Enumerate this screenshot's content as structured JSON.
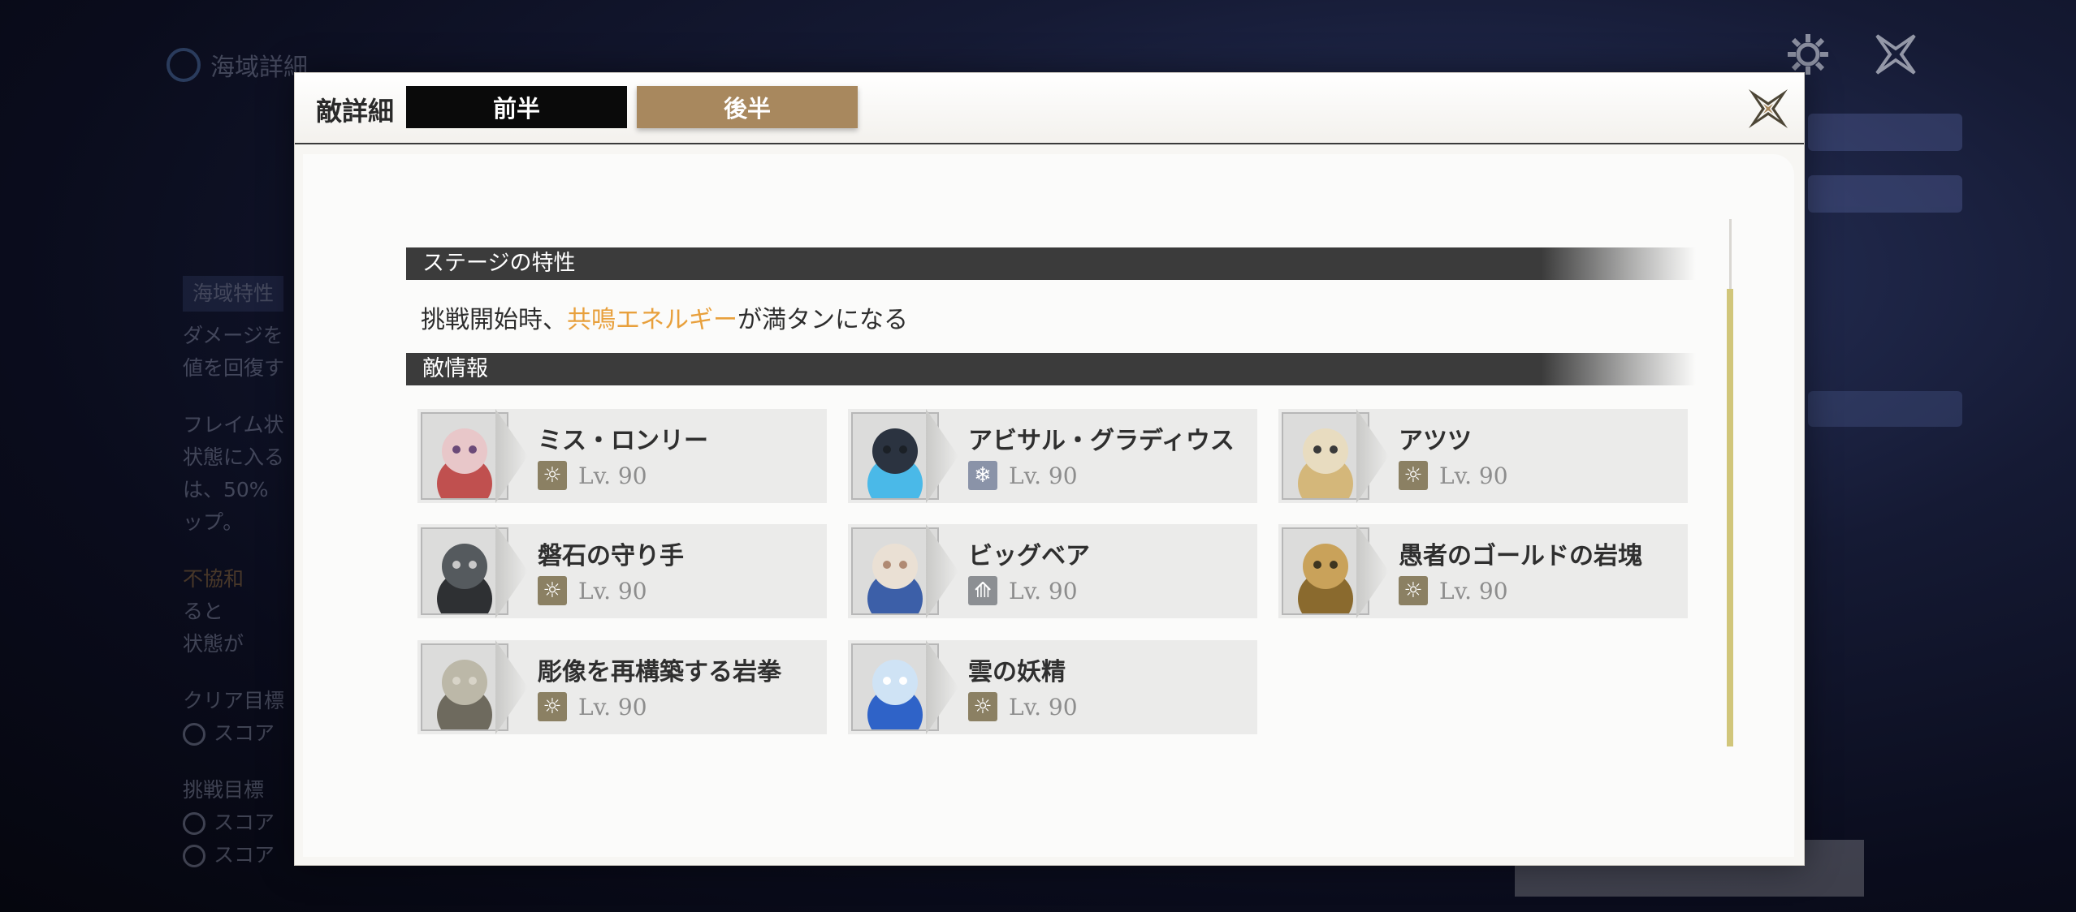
{
  "modal": {
    "title": "敵詳細",
    "tabs": [
      {
        "label": "前半",
        "active": true
      },
      {
        "label": "後半",
        "active": false
      }
    ],
    "stage_section_label": "ステージの特性",
    "stage_desc": {
      "prefix": "挑戦開始時、",
      "highlight": "共鳴エネルギー",
      "suffix": "が満タンになる",
      "highlight_color": "#e8a03c"
    },
    "enemy_section_label": "敵情報",
    "enemies": [
      {
        "name": "ミス・ロンリー",
        "level": "Lv. 90",
        "element_icon": "havoc-icon"
      },
      {
        "name": "アビサル・グラディウス",
        "level": "Lv. 90",
        "element_icon": "glacio-icon"
      },
      {
        "name": "アツツ",
        "level": "Lv. 90",
        "element_icon": "havoc-icon"
      },
      {
        "name": "磐石の守り手",
        "level": "Lv. 90",
        "element_icon": "havoc-icon"
      },
      {
        "name": "ビッグベア",
        "level": "Lv. 90",
        "element_icon": "aero-icon"
      },
      {
        "name": "愚者のゴールドの岩塊",
        "level": "Lv. 90",
        "element_icon": "havoc-icon"
      },
      {
        "name": "彫像を再構築する岩拳",
        "level": "Lv. 90",
        "element_icon": "havoc-icon"
      },
      {
        "name": "雲の妖精",
        "level": "Lv. 90",
        "element_icon": "havoc-icon"
      }
    ]
  },
  "background": {
    "location_title": "海域詳細",
    "sidebar_tag": "海域特性",
    "sidebar_lines": [
      "ダメージを",
      "値を回復す",
      "フレイム状",
      "状態に入る",
      "は、50%",
      "ップ。"
    ],
    "sidebar_orange": "不協和",
    "sidebar_lines2": [
      "ると",
      "状態が"
    ],
    "clear_label": "クリア目標",
    "challenge_label": "挑戦目標",
    "score_label": "スコア",
    "settings_icon": "gear-icon",
    "close_icon": "close-icon",
    "colors": {
      "accent": "#a8885e",
      "scroll": "#d1c67a"
    }
  }
}
